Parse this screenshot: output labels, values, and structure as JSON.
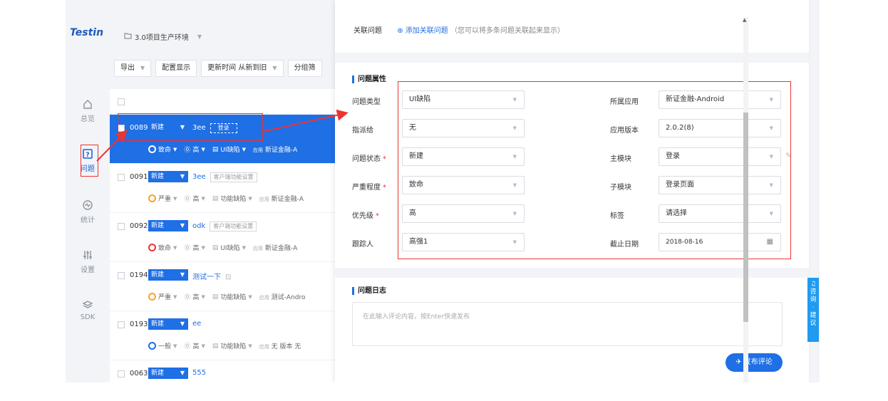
{
  "brand": "Testin",
  "project": "3.0项目生产环境",
  "sidebar": [
    {
      "label": "总览",
      "icon": "home-icon"
    },
    {
      "label": "问题",
      "icon": "issue-icon"
    },
    {
      "label": "统计",
      "icon": "stats-icon"
    },
    {
      "label": "设置",
      "icon": "settings-icon"
    },
    {
      "label": "SDK",
      "icon": "sdk-icon"
    }
  ],
  "toolbar": {
    "export": "导出",
    "config": "配置显示",
    "sort": "更新时间 从新到旧",
    "group": "分组筛"
  },
  "issues": [
    {
      "id": "0089",
      "status": "新建",
      "title": "3ee",
      "tag": "登录",
      "severity": "致命",
      "priority": "高",
      "type": "UI缺陷",
      "app_label": "应用",
      "app": "新证金融-A"
    },
    {
      "id": "0091",
      "status": "新建",
      "title": "3ee",
      "tag": "客户端功能设置",
      "severity": "严重",
      "priority": "高",
      "type": "功能缺陷",
      "app_label": "应用",
      "app": "新证金融-A"
    },
    {
      "id": "0092",
      "status": "新建",
      "title": "odk",
      "tag": "客户端功能设置",
      "severity": "致命",
      "priority": "高",
      "type": "UI缺陷",
      "app_label": "应用",
      "app": "新证金融-A"
    },
    {
      "id": "0194",
      "status": "新建",
      "title": "测试一下",
      "tag": "",
      "severity": "严重",
      "priority": "高",
      "type": "功能缺陷",
      "app_label": "应用",
      "app": "测试-Andro"
    },
    {
      "id": "0193",
      "status": "新建",
      "title": "ee",
      "tag": "",
      "severity": "一般",
      "priority": "高",
      "type": "功能缺陷",
      "app_label": "应用",
      "app": "无 版本 无"
    },
    {
      "id": "0063",
      "status": "新建",
      "title": "555",
      "tag": "",
      "severity": "",
      "priority": "",
      "type": "",
      "app_label": "",
      "app": ""
    }
  ],
  "panel": {
    "related_label": "关联问题",
    "add_related": "添加关联问题",
    "related_hint": "（您可以将多条问题关联起来显示）",
    "attr_title": "问题属性",
    "fields_left": [
      {
        "label": "问题类型",
        "value": "UI缺陷",
        "required": false
      },
      {
        "label": "指派给",
        "value": "无",
        "required": false
      },
      {
        "label": "问题状态",
        "value": "新建",
        "required": true
      },
      {
        "label": "严重程度",
        "value": "致命",
        "required": true
      },
      {
        "label": "优先级",
        "value": "高",
        "required": true
      },
      {
        "label": "跟踪人",
        "value": "高强1",
        "required": false
      }
    ],
    "fields_right": [
      {
        "label": "所属应用",
        "value": "新证金融-Android"
      },
      {
        "label": "应用版本",
        "value": "2.0.2(8)"
      },
      {
        "label": "主模块",
        "value": "登录"
      },
      {
        "label": "子模块",
        "value": "登录页面"
      },
      {
        "label": "标签",
        "value": "请选择"
      },
      {
        "label": "截止日期",
        "value": "2018-08-16"
      }
    ],
    "log_title": "问题日志",
    "comment_placeholder": "在此输入评论内容，按Enter快速发布",
    "publish": "发布评论"
  },
  "consult": "咨询·建议",
  "colors": {
    "accent": "#1f6fe5",
    "annotation": "#ee3333"
  }
}
